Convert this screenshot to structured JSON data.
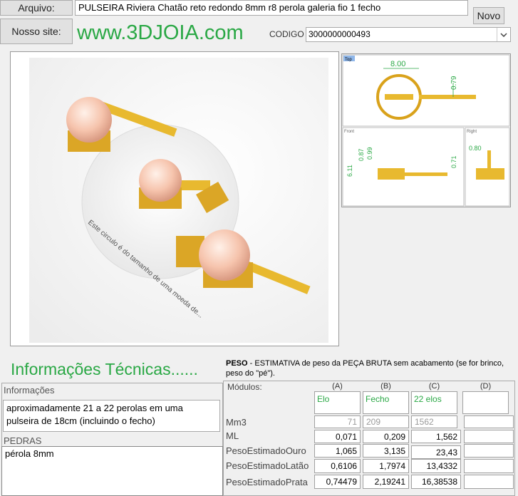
{
  "header": {
    "arquivo_label": "Arquivo:",
    "arquivo_value": "PULSEIRA Riviera Chatão reto redondo 8mm r8 perola galeria fio 1 fecho",
    "novo_label": "Novo",
    "site_button_label": "Nosso site:",
    "site_url": "www.3DJOIA.com",
    "codigo_label": "CODIGO",
    "codigo_value": "3000000000493"
  },
  "views": {
    "render_text": "Este circulo é do tamanho de uma moeda de...",
    "top_title": "Top",
    "front_title": "Front",
    "right_title": "Right",
    "dim_top_width": "8.00",
    "dim_top_side": "0.79",
    "dim_front_1": "6.11",
    "dim_front_2": "0.87",
    "dim_front_3": "0.99",
    "dim_front_4": "0.71",
    "dim_right_1": "0.80"
  },
  "info": {
    "heading": "Informações Técnicas......",
    "informacoes_label": "Informações",
    "informacoes_text": "aproximadamente 21 a 22 perolas em uma pulseira de 18cm (incluindo o fecho)",
    "pedras_label": "PEDRAS",
    "pedras_text": "pérola 8mm"
  },
  "peso": {
    "title": "PESO",
    "description": " -  ESTIMATIVA de peso da PEÇA BRUTA sem acabamento (se for brinco, peso do \"pé\").",
    "modulos_label": "Módulos:",
    "columns": [
      "(A)",
      "(B)",
      "(C)",
      "(D)"
    ],
    "column_names": [
      "Elo",
      "Fecho",
      "22 elos",
      ""
    ],
    "rows": [
      {
        "label": "Mm3",
        "values": [
          "71",
          "209",
          "1562",
          ""
        ]
      },
      {
        "label": "ML",
        "values": [
          "0,071",
          "0,209",
          "1,562",
          ""
        ]
      },
      {
        "label": "PesoEstimadoOuro",
        "values": [
          "1,065",
          "3,135",
          "23,43",
          ""
        ]
      },
      {
        "label": "PesoEstimadoLatão",
        "values": [
          "0,6106",
          "1,7974",
          "13,4332",
          ""
        ]
      },
      {
        "label": "PesoEstimadoPrata",
        "values": [
          "0,74479",
          "2,19241",
          "16,38538",
          ""
        ]
      }
    ]
  },
  "colors": {
    "site_green": "#2aa845",
    "gold": "#e8b92f",
    "pearl": "#f7c9b2"
  }
}
